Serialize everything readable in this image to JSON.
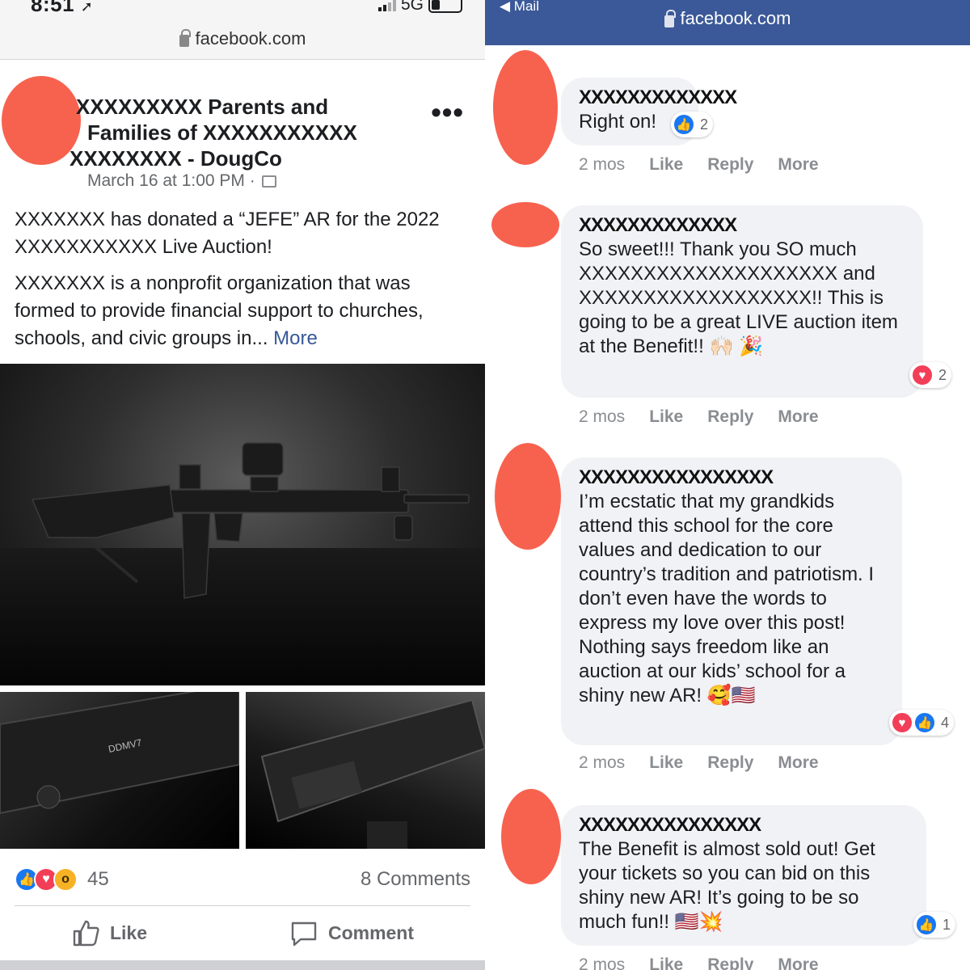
{
  "left": {
    "status": {
      "time": "8:51",
      "network": "5G"
    },
    "url": "facebook.com",
    "post": {
      "title_line1": "XXXXXXXXX Parents and",
      "title_line2": "Families of XXXXXXXXXXX",
      "title_line3": "XXXXXXXX - DougCo",
      "date": "March 16 at 1:00 PM ·",
      "more_dots": "•••",
      "body_p1": "XXXXXXX has donated a “JEFE” AR for the 2022 XXXXXXXXXXX Live Auction!",
      "body_p2": "XXXXXXX is a nonprofit organization that was formed to provide financial support to churches, schools, and civic groups in...",
      "see_more": "More",
      "photo_label": "DDMV7"
    },
    "reactions": {
      "count": "45",
      "comments": "8 Comments"
    },
    "actions": {
      "like": "Like",
      "comment": "Comment"
    }
  },
  "right": {
    "mail_back": "◀ Mail",
    "url": "facebook.com",
    "comments": [
      {
        "name": "XXXXXXXXXXXXX",
        "text": "Right on!",
        "time": "2 mos",
        "like": "Like",
        "reply": "Reply",
        "more": "More",
        "reaction_count": "2"
      },
      {
        "name": "XXXXXXXXXXXXX",
        "text": "So sweet!!! Thank you SO much XXXXXXXXXXXXXXXXXXXX and XXXXXXXXXXXXXXXXXX!! This is going to be a great LIVE auction item at the Benefit!! 🙌🏻 🎉",
        "time": "2 mos",
        "like": "Like",
        "reply": "Reply",
        "more": "More",
        "reaction_count": "2"
      },
      {
        "name": "XXXXXXXXXXXXXXXX",
        "text": "I’m ecstatic that my grandkids attend this school for the core values and dedication to our country’s tradition and patriotism. I don’t even have the words to express my love over this post! Nothing says freedom like an auction at our kids’ school for a shiny new AR! 🥰🇺🇸",
        "time": "2 mos",
        "like": "Like",
        "reply": "Reply",
        "more": "More",
        "reaction_count": "4"
      },
      {
        "name": "XXXXXXXXXXXXXXX",
        "text": "The Benefit is almost sold out! Get your tickets so you can bid on this shiny new AR! It’s going to be so much fun!! 🇺🇸💥",
        "time": "2 mos",
        "like": "Like",
        "reply": "Reply",
        "more": "More",
        "reaction_count": "1"
      }
    ]
  },
  "colors": {
    "facebook_blue": "#1877f2",
    "mail_bar": "#3b5998",
    "redaction_blob": "#f7624f",
    "love": "#f33e58",
    "wow": "#f7b125"
  },
  "icons": [
    "lock-icon",
    "signal-icon",
    "battery-icon",
    "location-arrow-icon",
    "audience-icon",
    "like-reaction-icon",
    "love-reaction-icon",
    "wow-reaction-icon",
    "thumbs-up-icon",
    "comment-bubble-icon"
  ]
}
